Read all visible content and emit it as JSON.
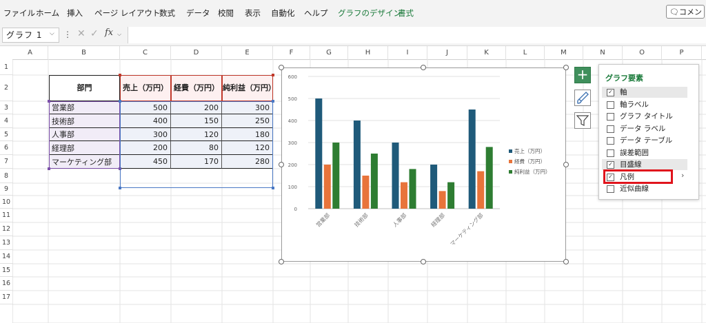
{
  "ribbon": {
    "tabs": [
      "ファイル",
      "ホーム",
      "挿入",
      "ページ レイアウト",
      "数式",
      "データ",
      "校閲",
      "表示",
      "自動化",
      "ヘルプ",
      "グラフのデザイン",
      "書式"
    ],
    "comment_label": "コメント"
  },
  "formula_bar": {
    "name_box": "グラフ 1",
    "fx": "fx",
    "value": ""
  },
  "columns": [
    "A",
    "B",
    "C",
    "D",
    "E",
    "F",
    "G",
    "H",
    "I",
    "J",
    "K",
    "L",
    "M",
    "N",
    "O",
    "P"
  ],
  "rows": [
    "1",
    "2",
    "3",
    "4",
    "5",
    "6",
    "7",
    "8",
    "9",
    "10",
    "11",
    "12",
    "13",
    "14",
    "15",
    "16",
    "17"
  ],
  "table": {
    "headers": [
      "部門",
      "売上（万円）",
      "経費（万円）",
      "純利益（万円）"
    ],
    "rows": [
      {
        "dept": "営業部",
        "sales": "500",
        "cost": "200",
        "profit": "300"
      },
      {
        "dept": "技術部",
        "sales": "400",
        "cost": "150",
        "profit": "250"
      },
      {
        "dept": "人事部",
        "sales": "300",
        "cost": "120",
        "profit": "180"
      },
      {
        "dept": "経理部",
        "sales": "200",
        "cost": "80",
        "profit": "120"
      },
      {
        "dept": "マーケティング部",
        "sales": "450",
        "cost": "170",
        "profit": "280"
      }
    ]
  },
  "chart_data": {
    "type": "bar",
    "categories": [
      "営業部",
      "技術部",
      "人事部",
      "経理部",
      "マーケティング部"
    ],
    "series": [
      {
        "name": "売上（万円）",
        "values": [
          500,
          400,
          300,
          200,
          450
        ],
        "color": "#1f5a7a"
      },
      {
        "name": "経費（万円）",
        "values": [
          200,
          150,
          120,
          80,
          170
        ],
        "color": "#e8743b"
      },
      {
        "name": "純利益（万円）",
        "values": [
          300,
          250,
          180,
          120,
          280
        ],
        "color": "#2e7d32"
      }
    ],
    "yticks": [
      "0",
      "100",
      "200",
      "300",
      "400",
      "500",
      "600"
    ],
    "ylim": [
      0,
      600
    ],
    "grid": true,
    "legend": "right"
  },
  "chart_elements_pane": {
    "title": "グラフ要素",
    "items": [
      {
        "label": "軸",
        "checked": true,
        "highlight": true
      },
      {
        "label": "軸ラベル",
        "checked": false,
        "highlight": false
      },
      {
        "label": "グラフ タイトル",
        "checked": false,
        "highlight": false
      },
      {
        "label": "データ ラベル",
        "checked": false,
        "highlight": false
      },
      {
        "label": "データ テーブル",
        "checked": false,
        "highlight": false
      },
      {
        "label": "誤差範囲",
        "checked": false,
        "highlight": false
      },
      {
        "label": "目盛線",
        "checked": true,
        "highlight": true
      },
      {
        "label": "凡例",
        "checked": true,
        "highlight": false
      },
      {
        "label": "近似曲線",
        "checked": false,
        "highlight": false
      }
    ],
    "check_mark": "✓",
    "chevron": "›"
  },
  "side_buttons": {
    "plus": "+"
  }
}
